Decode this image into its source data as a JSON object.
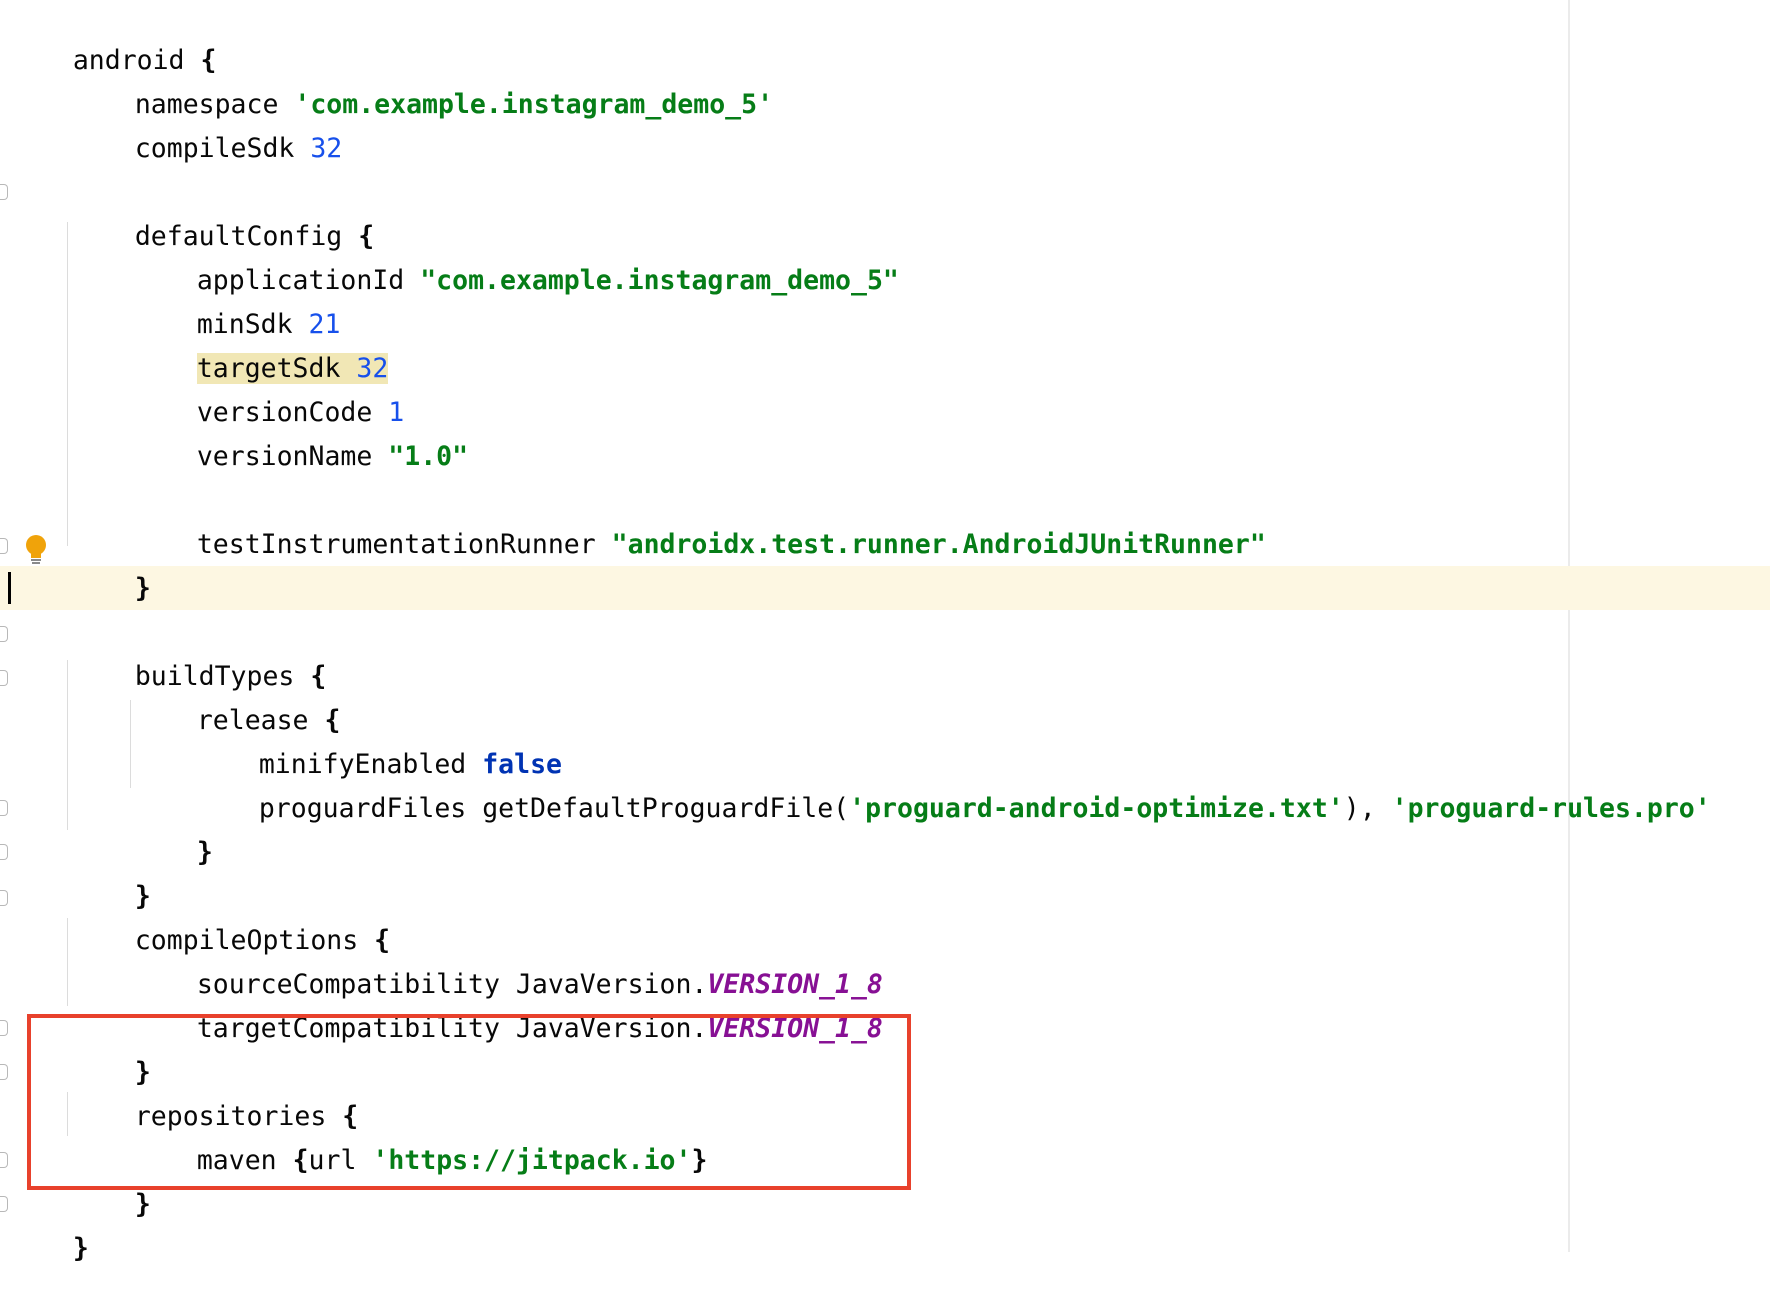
{
  "editor": {
    "lines": {
      "l0_key": "android",
      "l1_key": "namespace",
      "l1_val": "'com.example.instagram_demo_5'",
      "l2_key": "compileSdk",
      "l2_val": "32",
      "l4_key": "defaultConfig",
      "l5_key": "applicationId",
      "l5_val": "\"com.example.instagram_demo_5\"",
      "l6_key": "minSdk",
      "l6_val": "21",
      "l7_key": "targetSdk",
      "l7_val": "32",
      "l8_key": "versionCode",
      "l8_val": "1",
      "l9_key": "versionName",
      "l9_val": "\"1.0\"",
      "l11_key": "testInstrumentationRunner",
      "l11_val": "\"androidx.test.runner.AndroidJUnitRunner\"",
      "l14_key": "buildTypes",
      "l15_key": "release",
      "l16_key": "minifyEnabled",
      "l16_val": "false",
      "l17_key": "proguardFiles getDefaultProguardFile(",
      "l17_val1": "'proguard-android-optimize.txt'",
      "l17_mid": "), ",
      "l17_val2": "'proguard-rules.pro'",
      "l20_key": "compileOptions",
      "l21_key": "sourceCompatibility JavaVersion.",
      "l21_val": "VERSION_1_8",
      "l22_key": "targetCompatibility JavaVersion.",
      "l22_val": "VERSION_1_8",
      "l24_key": "repositories",
      "l25_key": "maven",
      "l25_mid": "url ",
      "l25_val": "'https://jitpack.io'",
      "open_brace": "{",
      "close_brace": "}"
    }
  },
  "colors": {
    "string": "#067d17",
    "number": "#1750eb",
    "keyword_bool": "#0033b3",
    "constant": "#871094",
    "caret_row": "#fdf7e2",
    "symbol_highlight": "#f1e7b5",
    "annotation_box": "#e8412c",
    "intention_bulb": "#f0a30a"
  },
  "icons": {
    "intention": "lightbulb-icon",
    "fold": "fold-marker-icon"
  }
}
